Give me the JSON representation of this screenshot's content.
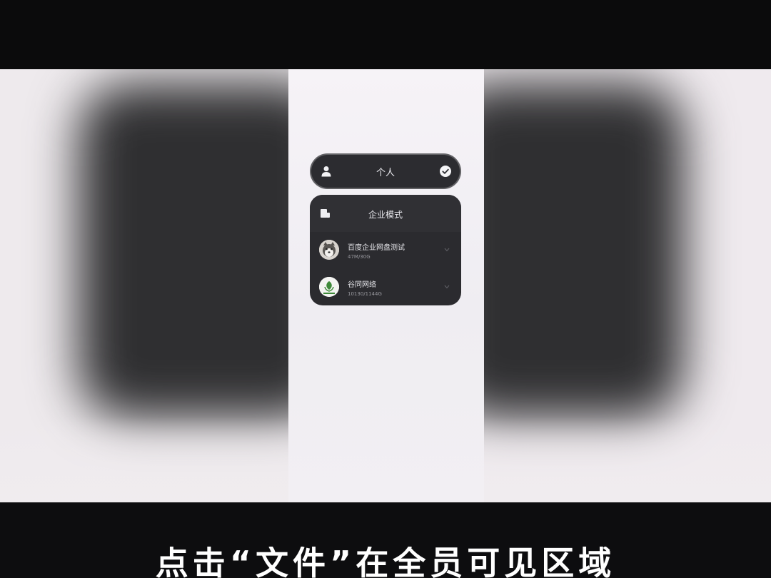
{
  "switcher": {
    "personal_label": "个人",
    "personal_selected": true,
    "enterprise_title": "企业模式",
    "orgs": [
      {
        "name": "百度企业网盘测试",
        "usage": "47M/30G",
        "avatar": "husky-dog-avatar"
      },
      {
        "name": "谷同网络",
        "usage": "10130/1144G",
        "avatar": "green-leaf-logo"
      }
    ]
  },
  "caption": "点击“文件”在全员可见区域",
  "colors": {
    "panel_bg": "#2c2c30",
    "phone_bg": "#f4f1f5",
    "letterbox": "#0d0d0f",
    "caption_text": "#ffffff"
  }
}
